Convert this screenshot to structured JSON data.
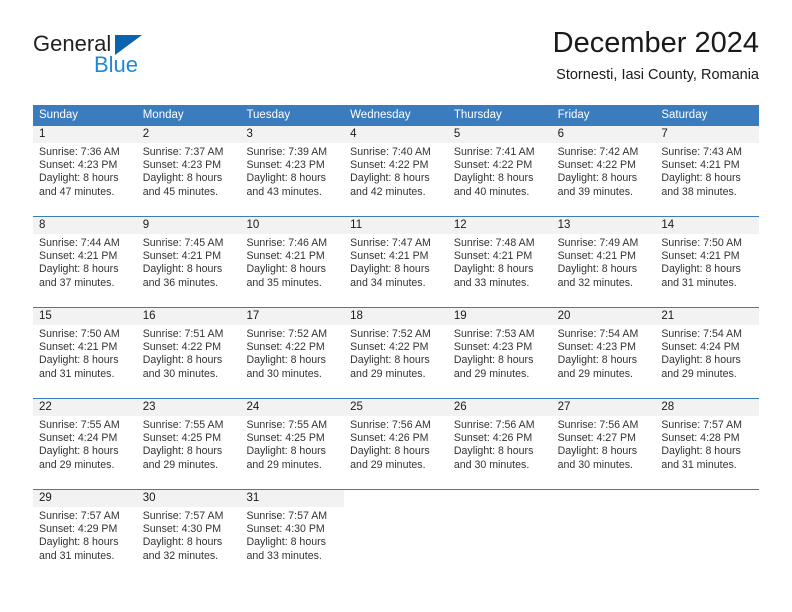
{
  "brand": {
    "name_top": "General",
    "name_bottom": "Blue",
    "triangle_color": "#0b63b0",
    "bottom_color": "#1d8ad6"
  },
  "header": {
    "title": "December 2024",
    "subtitle": "Stornesti, Iasi County, Romania"
  },
  "theme": {
    "header_blue": "#3a7cbe",
    "day_band_gray": "#f2f2f2",
    "text": "#333333"
  },
  "weekdays": [
    "Sunday",
    "Monday",
    "Tuesday",
    "Wednesday",
    "Thursday",
    "Friday",
    "Saturday"
  ],
  "weeks": [
    [
      {
        "day": "1",
        "sunrise": "Sunrise: 7:36 AM",
        "sunset": "Sunset: 4:23 PM",
        "daylight1": "Daylight: 8 hours",
        "daylight2": "and 47 minutes."
      },
      {
        "day": "2",
        "sunrise": "Sunrise: 7:37 AM",
        "sunset": "Sunset: 4:23 PM",
        "daylight1": "Daylight: 8 hours",
        "daylight2": "and 45 minutes."
      },
      {
        "day": "3",
        "sunrise": "Sunrise: 7:39 AM",
        "sunset": "Sunset: 4:23 PM",
        "daylight1": "Daylight: 8 hours",
        "daylight2": "and 43 minutes."
      },
      {
        "day": "4",
        "sunrise": "Sunrise: 7:40 AM",
        "sunset": "Sunset: 4:22 PM",
        "daylight1": "Daylight: 8 hours",
        "daylight2": "and 42 minutes."
      },
      {
        "day": "5",
        "sunrise": "Sunrise: 7:41 AM",
        "sunset": "Sunset: 4:22 PM",
        "daylight1": "Daylight: 8 hours",
        "daylight2": "and 40 minutes."
      },
      {
        "day": "6",
        "sunrise": "Sunrise: 7:42 AM",
        "sunset": "Sunset: 4:22 PM",
        "daylight1": "Daylight: 8 hours",
        "daylight2": "and 39 minutes."
      },
      {
        "day": "7",
        "sunrise": "Sunrise: 7:43 AM",
        "sunset": "Sunset: 4:21 PM",
        "daylight1": "Daylight: 8 hours",
        "daylight2": "and 38 minutes."
      }
    ],
    [
      {
        "day": "8",
        "sunrise": "Sunrise: 7:44 AM",
        "sunset": "Sunset: 4:21 PM",
        "daylight1": "Daylight: 8 hours",
        "daylight2": "and 37 minutes."
      },
      {
        "day": "9",
        "sunrise": "Sunrise: 7:45 AM",
        "sunset": "Sunset: 4:21 PM",
        "daylight1": "Daylight: 8 hours",
        "daylight2": "and 36 minutes."
      },
      {
        "day": "10",
        "sunrise": "Sunrise: 7:46 AM",
        "sunset": "Sunset: 4:21 PM",
        "daylight1": "Daylight: 8 hours",
        "daylight2": "and 35 minutes."
      },
      {
        "day": "11",
        "sunrise": "Sunrise: 7:47 AM",
        "sunset": "Sunset: 4:21 PM",
        "daylight1": "Daylight: 8 hours",
        "daylight2": "and 34 minutes."
      },
      {
        "day": "12",
        "sunrise": "Sunrise: 7:48 AM",
        "sunset": "Sunset: 4:21 PM",
        "daylight1": "Daylight: 8 hours",
        "daylight2": "and 33 minutes."
      },
      {
        "day": "13",
        "sunrise": "Sunrise: 7:49 AM",
        "sunset": "Sunset: 4:21 PM",
        "daylight1": "Daylight: 8 hours",
        "daylight2": "and 32 minutes."
      },
      {
        "day": "14",
        "sunrise": "Sunrise: 7:50 AM",
        "sunset": "Sunset: 4:21 PM",
        "daylight1": "Daylight: 8 hours",
        "daylight2": "and 31 minutes."
      }
    ],
    [
      {
        "day": "15",
        "sunrise": "Sunrise: 7:50 AM",
        "sunset": "Sunset: 4:21 PM",
        "daylight1": "Daylight: 8 hours",
        "daylight2": "and 31 minutes."
      },
      {
        "day": "16",
        "sunrise": "Sunrise: 7:51 AM",
        "sunset": "Sunset: 4:22 PM",
        "daylight1": "Daylight: 8 hours",
        "daylight2": "and 30 minutes."
      },
      {
        "day": "17",
        "sunrise": "Sunrise: 7:52 AM",
        "sunset": "Sunset: 4:22 PM",
        "daylight1": "Daylight: 8 hours",
        "daylight2": "and 30 minutes."
      },
      {
        "day": "18",
        "sunrise": "Sunrise: 7:52 AM",
        "sunset": "Sunset: 4:22 PM",
        "daylight1": "Daylight: 8 hours",
        "daylight2": "and 29 minutes."
      },
      {
        "day": "19",
        "sunrise": "Sunrise: 7:53 AM",
        "sunset": "Sunset: 4:23 PM",
        "daylight1": "Daylight: 8 hours",
        "daylight2": "and 29 minutes."
      },
      {
        "day": "20",
        "sunrise": "Sunrise: 7:54 AM",
        "sunset": "Sunset: 4:23 PM",
        "daylight1": "Daylight: 8 hours",
        "daylight2": "and 29 minutes."
      },
      {
        "day": "21",
        "sunrise": "Sunrise: 7:54 AM",
        "sunset": "Sunset: 4:24 PM",
        "daylight1": "Daylight: 8 hours",
        "daylight2": "and 29 minutes."
      }
    ],
    [
      {
        "day": "22",
        "sunrise": "Sunrise: 7:55 AM",
        "sunset": "Sunset: 4:24 PM",
        "daylight1": "Daylight: 8 hours",
        "daylight2": "and 29 minutes."
      },
      {
        "day": "23",
        "sunrise": "Sunrise: 7:55 AM",
        "sunset": "Sunset: 4:25 PM",
        "daylight1": "Daylight: 8 hours",
        "daylight2": "and 29 minutes."
      },
      {
        "day": "24",
        "sunrise": "Sunrise: 7:55 AM",
        "sunset": "Sunset: 4:25 PM",
        "daylight1": "Daylight: 8 hours",
        "daylight2": "and 29 minutes."
      },
      {
        "day": "25",
        "sunrise": "Sunrise: 7:56 AM",
        "sunset": "Sunset: 4:26 PM",
        "daylight1": "Daylight: 8 hours",
        "daylight2": "and 29 minutes."
      },
      {
        "day": "26",
        "sunrise": "Sunrise: 7:56 AM",
        "sunset": "Sunset: 4:26 PM",
        "daylight1": "Daylight: 8 hours",
        "daylight2": "and 30 minutes."
      },
      {
        "day": "27",
        "sunrise": "Sunrise: 7:56 AM",
        "sunset": "Sunset: 4:27 PM",
        "daylight1": "Daylight: 8 hours",
        "daylight2": "and 30 minutes."
      },
      {
        "day": "28",
        "sunrise": "Sunrise: 7:57 AM",
        "sunset": "Sunset: 4:28 PM",
        "daylight1": "Daylight: 8 hours",
        "daylight2": "and 31 minutes."
      }
    ],
    [
      {
        "day": "29",
        "sunrise": "Sunrise: 7:57 AM",
        "sunset": "Sunset: 4:29 PM",
        "daylight1": "Daylight: 8 hours",
        "daylight2": "and 31 minutes."
      },
      {
        "day": "30",
        "sunrise": "Sunrise: 7:57 AM",
        "sunset": "Sunset: 4:30 PM",
        "daylight1": "Daylight: 8 hours",
        "daylight2": "and 32 minutes."
      },
      {
        "day": "31",
        "sunrise": "Sunrise: 7:57 AM",
        "sunset": "Sunset: 4:30 PM",
        "daylight1": "Daylight: 8 hours",
        "daylight2": "and 33 minutes."
      },
      {
        "day": "",
        "sunrise": "",
        "sunset": "",
        "daylight1": "",
        "daylight2": ""
      },
      {
        "day": "",
        "sunrise": "",
        "sunset": "",
        "daylight1": "",
        "daylight2": ""
      },
      {
        "day": "",
        "sunrise": "",
        "sunset": "",
        "daylight1": "",
        "daylight2": ""
      },
      {
        "day": "",
        "sunrise": "",
        "sunset": "",
        "daylight1": "",
        "daylight2": ""
      }
    ]
  ]
}
